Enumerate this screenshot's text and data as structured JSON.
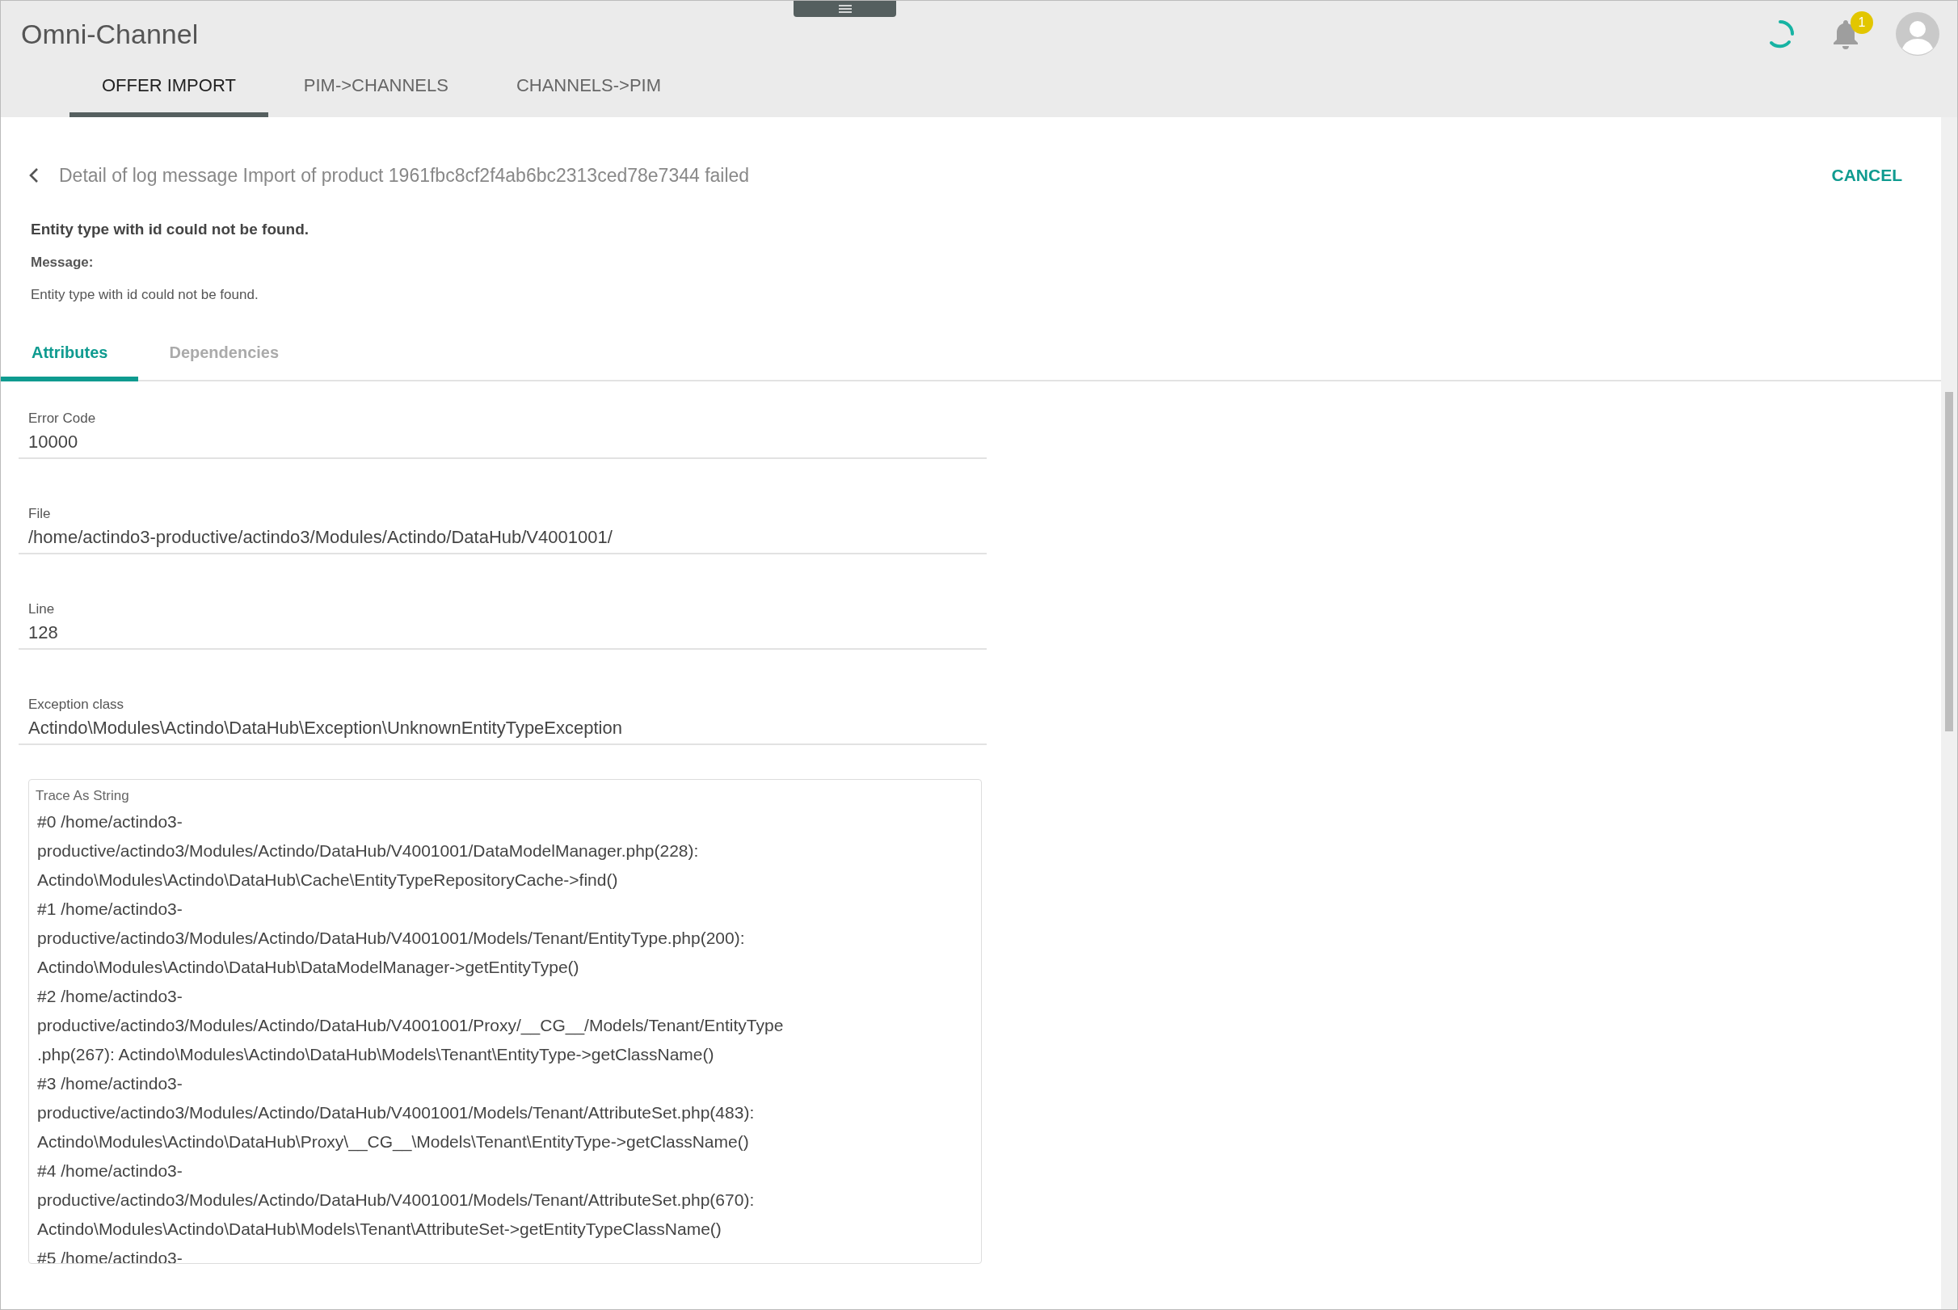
{
  "app": {
    "title": "Omni-Channel",
    "notification_count": "1"
  },
  "tabs": [
    {
      "label": "OFFER IMPORT",
      "selected": true
    },
    {
      "label": "PIM->CHANNELS",
      "selected": false
    },
    {
      "label": "CHANNELS->PIM",
      "selected": false
    }
  ],
  "detail": {
    "title": "Detail of log message Import of product 1961fbc8cf2f4ab6bc2313ced78e7344 failed",
    "cancel": "CANCEL",
    "summary": "Entity type with id could not be found.",
    "message_label": "Message:",
    "message": "Entity type with id could not be found."
  },
  "subtabs": [
    {
      "label": "Attributes",
      "selected": true
    },
    {
      "label": "Dependencies",
      "selected": false
    }
  ],
  "fields": [
    {
      "label": "Error Code",
      "value": "10000"
    },
    {
      "label": "File",
      "value": "/home/actindo3-productive/actindo3/Modules/Actindo/DataHub/V4001001/"
    },
    {
      "label": "Line",
      "value": "128"
    },
    {
      "label": "Exception class",
      "value": "Actindo\\Modules\\Actindo\\DataHub\\Exception\\UnknownEntityTypeException"
    }
  ],
  "trace": {
    "label": "Trace As String",
    "lines": [
      "#0 /home/actindo3-",
      "productive/actindo3/Modules/Actindo/DataHub/V4001001/DataModelManager.php(228):",
      "Actindo\\Modules\\Actindo\\DataHub\\Cache\\EntityTypeRepositoryCache->find()",
      "#1 /home/actindo3-",
      "productive/actindo3/Modules/Actindo/DataHub/V4001001/Models/Tenant/EntityType.php(200):",
      "Actindo\\Modules\\Actindo\\DataHub\\DataModelManager->getEntityType()",
      "#2 /home/actindo3-",
      "productive/actindo3/Modules/Actindo/DataHub/V4001001/Proxy/__CG__/Models/Tenant/EntityType",
      ".php(267): Actindo\\Modules\\Actindo\\DataHub\\Models\\Tenant\\EntityType->getClassName()",
      "#3 /home/actindo3-",
      "productive/actindo3/Modules/Actindo/DataHub/V4001001/Models/Tenant/AttributeSet.php(483):",
      "Actindo\\Modules\\Actindo\\DataHub\\Proxy\\__CG__\\Models\\Tenant\\EntityType->getClassName()",
      "#4 /home/actindo3-",
      "productive/actindo3/Modules/Actindo/DataHub/V4001001/Models/Tenant/AttributeSet.php(670):",
      "Actindo\\Modules\\Actindo\\DataHub\\Models\\Tenant\\AttributeSet->getEntityTypeClassName()",
      "#5 /home/actindo3-"
    ]
  }
}
